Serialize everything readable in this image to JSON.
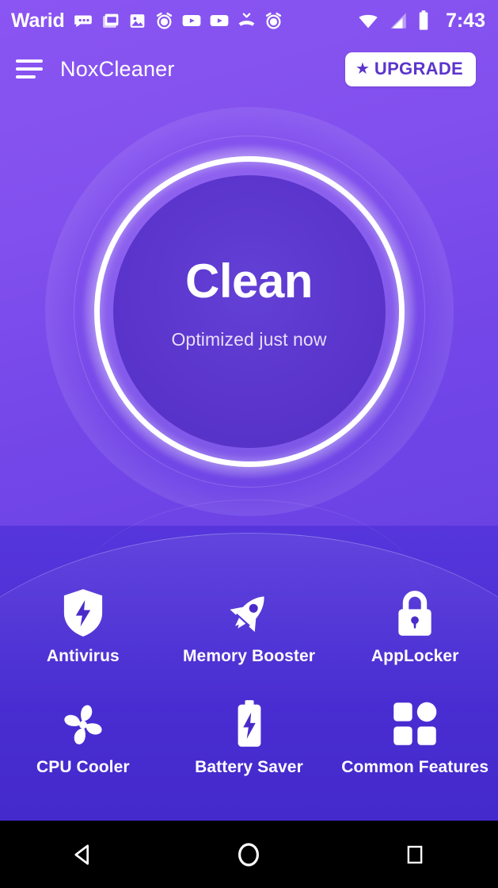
{
  "status_bar": {
    "carrier": "Warid",
    "time": "7:43",
    "notification_icons": [
      "message-icon",
      "news-icon",
      "image-icon",
      "alarm-icon",
      "video-player-icon",
      "video-player-icon-2",
      "missed-call-icon",
      "alarm-icon-2"
    ],
    "system_icons": [
      "wifi-icon",
      "signal-icon",
      "battery-icon"
    ]
  },
  "app_bar": {
    "menu_icon": "hamburger-menu-icon",
    "title": "NoxCleaner",
    "upgrade_label": "UPGRADE",
    "upgrade_star": "★"
  },
  "hero": {
    "button_label": "Clean",
    "status_text": "Optimized just now"
  },
  "features": [
    {
      "label": "Antivirus",
      "icon": "shield-bolt-icon"
    },
    {
      "label": "Memory Booster",
      "icon": "rocket-icon"
    },
    {
      "label": "AppLocker",
      "icon": "lock-icon"
    },
    {
      "label": "CPU Cooler",
      "icon": "fan-icon"
    },
    {
      "label": "Battery Saver",
      "icon": "battery-bolt-icon"
    },
    {
      "label": "Common Features",
      "icon": "grid-apps-icon"
    }
  ],
  "nav_bar": {
    "back": "back-triangle-icon",
    "home": "home-circle-icon",
    "recents": "recents-square-icon"
  },
  "colors": {
    "bg_top": "#8250EE",
    "bg_bottom": "#4429CC",
    "inner_circle": "#5B35CC",
    "accent_white": "#FFFFFF",
    "upgrade_text": "#5B35CC"
  }
}
